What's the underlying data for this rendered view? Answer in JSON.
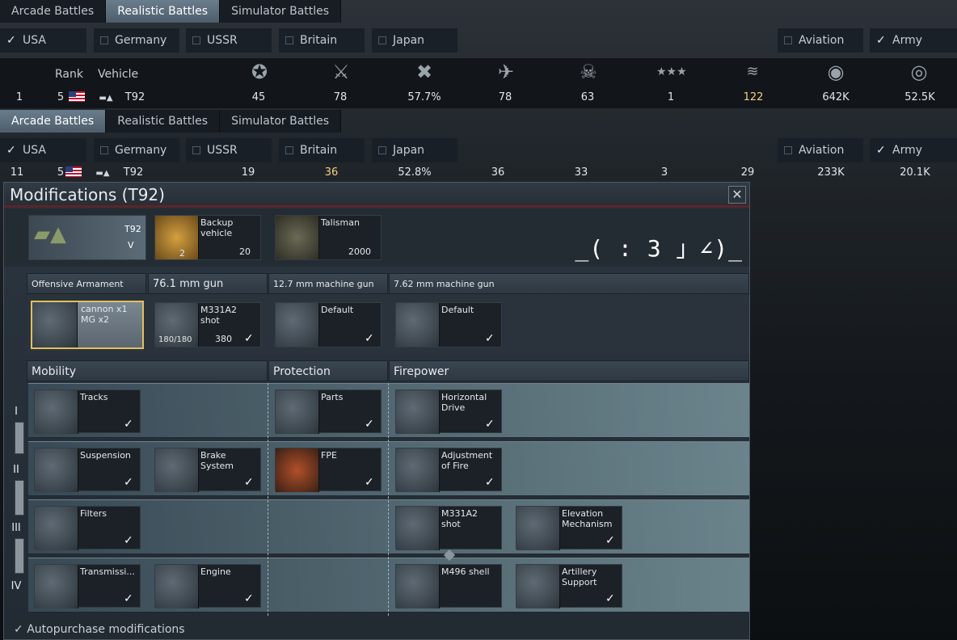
{
  "top_tabs": [
    "Arcade Battles",
    "Realistic Battles",
    "Simulator Battles"
  ],
  "top_active": 1,
  "filters": [
    {
      "label": "USA",
      "checked": true
    },
    {
      "label": "Germany",
      "checked": false
    },
    {
      "label": "USSR",
      "checked": false
    },
    {
      "label": "Britain",
      "checked": false
    },
    {
      "label": "Japan",
      "checked": false
    },
    {
      "label": "Aviation",
      "checked": false
    },
    {
      "label": "Army",
      "checked": true
    }
  ],
  "stats_header": {
    "rank": "Rank",
    "vehicle": "Vehicle"
  },
  "stats_row1": {
    "place": "1",
    "rank": "5",
    "vehicle": "T92",
    "v1": "45",
    "v2": "78",
    "v3": "57.7%",
    "v4": "78",
    "v5": "63",
    "v6": "1",
    "v7": "122",
    "v8": "642K",
    "v9": "52.5K"
  },
  "second_tabs": [
    "Arcade Battles",
    "Realistic Battles",
    "Simulator Battles"
  ],
  "second_active": 0,
  "stats_row2": {
    "place": "11",
    "rank": "5",
    "vehicle": "T92",
    "v1": "19",
    "v2": "36",
    "v3": "52.8%",
    "v4": "36",
    "v5": "33",
    "v6": "3",
    "v7": "29",
    "v8": "233K",
    "v9": "20.1K"
  },
  "highlight_color": "#f5d080",
  "modal": {
    "title": "Modifications (T92)",
    "vehicle_tag": "T92",
    "vehicle_rank": "V",
    "backup": {
      "label": "Backup vehicle",
      "count": "2",
      "cost": "20"
    },
    "talisman": {
      "label": "Talisman",
      "cost": "2000"
    },
    "kaomoji": "_( : 3 」∠)_",
    "arm_headers": [
      "Offensive Armament",
      "76.1 mm gun",
      "12.7 mm machine gun",
      "7.62 mm machine gun"
    ],
    "armament_sel": "cannon x1 MG x2",
    "ammo": [
      {
        "label": "M331A2 shot",
        "count": "180/180",
        "cost": "380"
      },
      {
        "label": "Default"
      },
      {
        "label": "Default"
      }
    ],
    "sections": [
      "Mobility",
      "Protection",
      "Firepower"
    ],
    "tiers": [
      "I",
      "II",
      "III",
      "IV"
    ],
    "mods": {
      "t1": [
        "Tracks",
        "Parts",
        "Horizontal Drive"
      ],
      "t2": [
        "Suspension",
        "Brake System",
        "FPE",
        "Adjustment of Fire"
      ],
      "t3": [
        "Filters",
        "M331A2 shot",
        "Elevation Mechanism"
      ],
      "t4": [
        "Transmissi...",
        "Engine",
        "M496 shell",
        "Artillery Support"
      ]
    },
    "autopurchase": "Autopurchase modifications"
  }
}
